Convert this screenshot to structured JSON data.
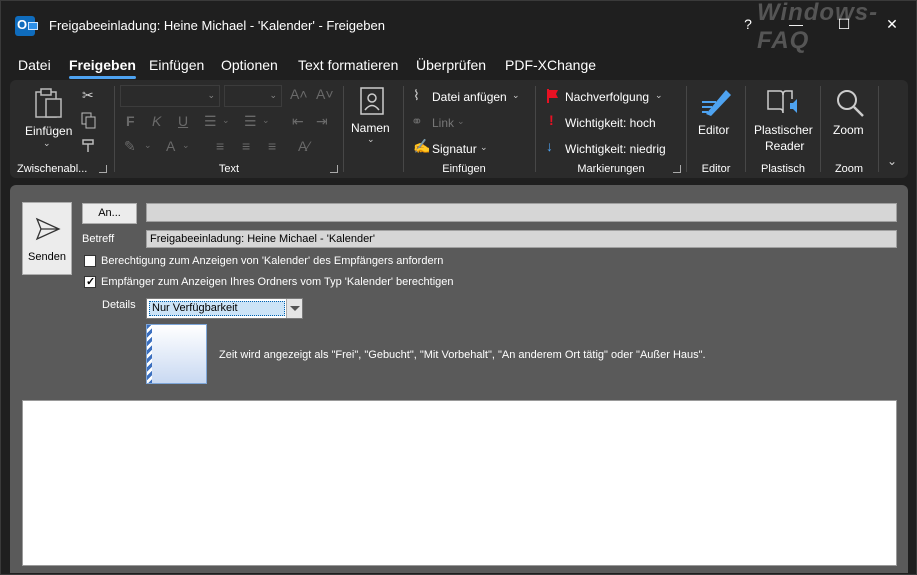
{
  "window": {
    "title": "Freigabeeinladung: Heine Michael - 'Kalender'  -  Freigeben",
    "help": "?",
    "minimize": "—",
    "maximize": "☐",
    "close": "✕",
    "watermark": "Windows-FAQ"
  },
  "menu": {
    "tabs": [
      {
        "label": "Datei"
      },
      {
        "label": "Freigeben",
        "active": true
      },
      {
        "label": "Einfügen"
      },
      {
        "label": "Optionen"
      },
      {
        "label": "Text formatieren"
      },
      {
        "label": "Überprüfen"
      },
      {
        "label": "PDF-XChange"
      }
    ]
  },
  "ribbon": {
    "clipboard": {
      "paste": "Einfügen",
      "label": "Zwischenabl..."
    },
    "text": {
      "bold": "F",
      "italic": "K",
      "underline": "U",
      "label": "Text"
    },
    "names": {
      "button": "Namen"
    },
    "insert": {
      "attach": "Datei anfügen",
      "link": "Link",
      "signature": "Signatur",
      "label": "Einfügen"
    },
    "tags": {
      "followup": "Nachverfolgung",
      "high": "Wichtigkeit: hoch",
      "low": "Wichtigkeit: niedrig",
      "label": "Markierungen"
    },
    "editor": {
      "button": "Editor",
      "label": "Editor"
    },
    "reader": {
      "button_line1": "Plastischer",
      "button_line2": "Reader",
      "label": "Plastisch"
    },
    "zoom": {
      "button": "Zoom",
      "label": "Zoom"
    }
  },
  "compose": {
    "send": "Senden",
    "to_button": "An...",
    "to_value": "",
    "subject_label": "Betreff",
    "subject_value": "Freigabeeinladung: Heine Michael - 'Kalender'",
    "checkbox1": {
      "label": "Berechtigung zum Anzeigen von 'Kalender' des Empfängers anfordern",
      "checked": false
    },
    "checkbox2": {
      "label": "Empfänger zum Anzeigen Ihres Ordners vom Typ 'Kalender' berechtigen",
      "checked": true
    },
    "details_label": "Details",
    "details_value": "Nur Verfügbarkeit",
    "details_desc": "Zeit wird angezeigt als \"Frei\", \"Gebucht\", \"Mit Vorbehalt\", \"An anderem Ort tätig\" oder \"Außer Haus\"."
  },
  "colors": {
    "background": "#1f1f1f",
    "ribbon": "#2b2b2b",
    "compose": "#5a5a5a",
    "accent": "#4ea3f1",
    "flag": "#e81123"
  }
}
